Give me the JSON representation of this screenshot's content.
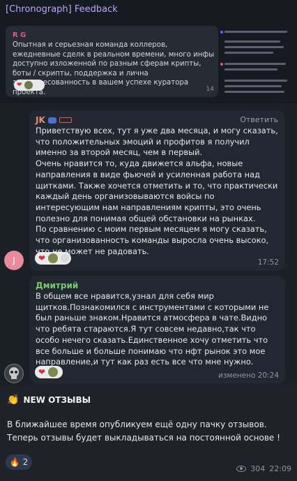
{
  "embedded_screenshot": {
    "title": "[Chronograph] Feedback",
    "message": {
      "sender": "R G",
      "text": "Опытная  и серьезная команда коллеров, ежедневные сделк в реальном времени, много инфы доступно изложенной по разным сферам крипты, боты / скрипты, поддержка и лична заинтересованность в вашем успехе куратора проекта.",
      "time": "14"
    }
  },
  "messages": [
    {
      "avatar_letter": "J",
      "sender": "JK",
      "reply_label": "Ответить",
      "text": "Приветствую всех, тут я уже два месяца, и могу сказать, что положительных эмоций и профитов я получил именно за второй месяц, чем в первый.\nОчень нравится то, куда движется альфа, новые направления в виде фьючей и усиленная работа над щитками. Также хочется отметить и то, что практически каждый день организовываются войсы по интересующим нам направлениям крипты, это очень полезно для понимая общей обстановки на рынках.\nПо сравнению с моим первым месяцем я могу сказать, что организованность команды выросла очень высоко, что не может не радовать.",
      "time": "17:52"
    },
    {
      "sender": "Дмитрий",
      "text": "В общем все нравится,узнал для себя мир щитков.Познакомился с инструментами с которыми не был раньше знаком.Нравится атмосфера в чате.Видно что ребята стараются.Я тут совсем недавно,так что особо нечего сказать.Единственное хочу отметить что все больше и больше понимаю что нфт рынок это мое направление,и тут как раз есть все что мне нужно.",
      "time": "изменено 20:24"
    }
  ],
  "post": {
    "title": "NEW ОТЗЫВЫ",
    "body": "В ближайшее время опубликуем ещё одну пачку отзывов. Теперь отзывы будет выкладываться на постоянной основе !",
    "reaction_count": "2",
    "views": "304",
    "time": "22:09"
  },
  "colors": {
    "accent": "#bda6ff",
    "sender_j": "#f08b6e",
    "sender_d": "#79c96b"
  }
}
